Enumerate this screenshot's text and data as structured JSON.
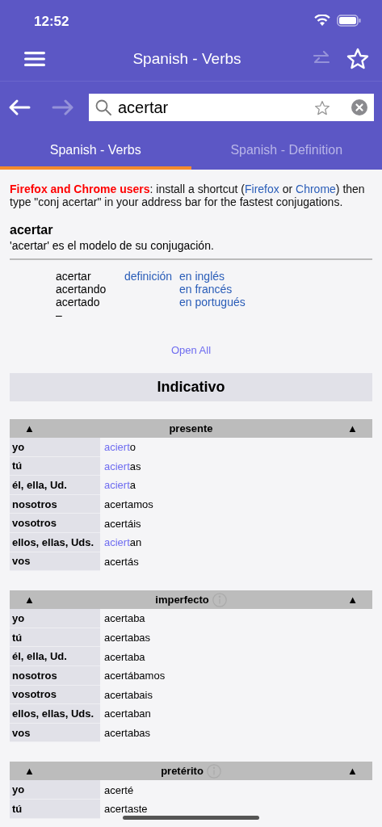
{
  "status_bar": {
    "time": "12:52"
  },
  "nav_bar": {
    "title": "Spanish - Verbs",
    "swap_disabled": true
  },
  "search": {
    "value": "acertar",
    "forward_disabled": true
  },
  "tabs": [
    {
      "label": "Spanish - Verbs",
      "selected": true
    },
    {
      "label": "Spanish - Definition",
      "selected": false
    }
  ],
  "notice": [
    {
      "kind": "highlight",
      "text": "Firefox and Chrome users"
    },
    {
      "kind": "text",
      "text": ": install a shortcut ("
    },
    {
      "kind": "link",
      "text": "Firefox"
    },
    {
      "kind": "text",
      "text": " or "
    },
    {
      "kind": "link",
      "text": "Chrome"
    },
    {
      "kind": "text",
      "text": ") then type \"conj acertar\" in your address bar for the fastest conjugations."
    }
  ],
  "verb": {
    "title": "acertar",
    "model": "'acertar' es el modelo de su conjugación."
  },
  "forms": [
    {
      "form": "acertar",
      "definition": "definición",
      "translation": "en inglés"
    },
    {
      "form": "acertando",
      "translation": "en francés"
    },
    {
      "form": "acertado",
      "translation": "en portugués"
    },
    {
      "form": "–"
    }
  ],
  "open_all": "Open All",
  "mood": "Indicativo",
  "tenses": [
    {
      "name": "presente",
      "toggle": "▲",
      "info": false,
      "rows": [
        {
          "person": "yo",
          "form": [
            {
              "text": "aciert",
              "irregular": true
            },
            {
              "text": "o",
              "irregular": false
            }
          ]
        },
        {
          "person": "tú",
          "form": [
            {
              "text": "aciert",
              "irregular": true
            },
            {
              "text": "as",
              "irregular": false
            }
          ]
        },
        {
          "person": "él, ella, Ud.",
          "form": [
            {
              "text": "aciert",
              "irregular": true
            },
            {
              "text": "a",
              "irregular": false
            }
          ]
        },
        {
          "person": "nosotros",
          "form": [
            {
              "text": "acertamos",
              "irregular": false
            }
          ]
        },
        {
          "person": "vosotros",
          "form": [
            {
              "text": "acertáis",
              "irregular": false
            }
          ]
        },
        {
          "person": "ellos, ellas, Uds.",
          "form": [
            {
              "text": "aciert",
              "irregular": true
            },
            {
              "text": "an",
              "irregular": false
            }
          ]
        },
        {
          "person": "vos",
          "form": [
            {
              "text": "acertás",
              "irregular": false
            }
          ]
        }
      ]
    },
    {
      "name": "imperfecto",
      "toggle": "▲",
      "info": true,
      "rows": [
        {
          "person": "yo",
          "form": [
            {
              "text": "acertaba",
              "irregular": false
            }
          ]
        },
        {
          "person": "tú",
          "form": [
            {
              "text": "acertabas",
              "irregular": false
            }
          ]
        },
        {
          "person": "él, ella, Ud.",
          "form": [
            {
              "text": "acertaba",
              "irregular": false
            }
          ]
        },
        {
          "person": "nosotros",
          "form": [
            {
              "text": "acertábamos",
              "irregular": false
            }
          ]
        },
        {
          "person": "vosotros",
          "form": [
            {
              "text": "acertabais",
              "irregular": false
            }
          ]
        },
        {
          "person": "ellos, ellas, Uds.",
          "form": [
            {
              "text": "acertaban",
              "irregular": false
            }
          ]
        },
        {
          "person": "vos",
          "form": [
            {
              "text": "acertabas",
              "irregular": false
            }
          ]
        }
      ]
    },
    {
      "name": "pretérito",
      "toggle": "▲",
      "info": true,
      "rows": [
        {
          "person": "yo",
          "form": [
            {
              "text": "acerté",
              "irregular": false
            }
          ]
        },
        {
          "person": "tú",
          "form": [
            {
              "text": "acertaste",
              "irregular": false
            }
          ]
        }
      ]
    }
  ]
}
